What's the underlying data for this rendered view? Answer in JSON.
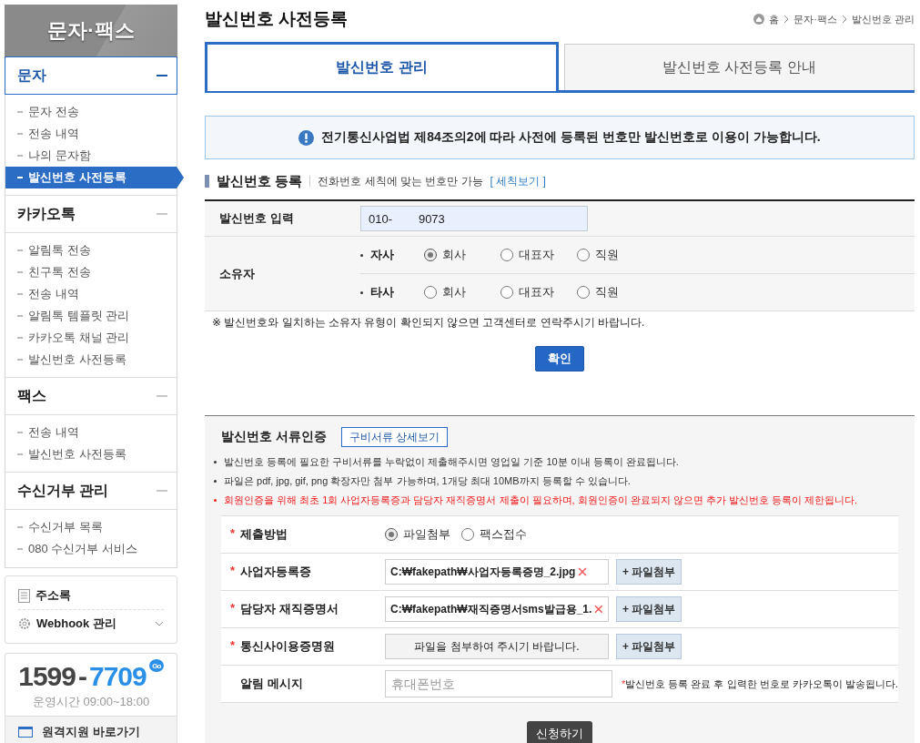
{
  "sidebar": {
    "title": "문자·팩스",
    "groups": [
      {
        "title": "문자",
        "selected": true,
        "expanded": true,
        "items": [
          {
            "label": "문자 전송",
            "selected": false
          },
          {
            "label": "전송 내역",
            "selected": false
          },
          {
            "label": "나의 문자함",
            "selected": false
          },
          {
            "label": "발신번호 사전등록",
            "selected": true
          }
        ]
      },
      {
        "title": "카카오톡",
        "selected": false,
        "expanded": true,
        "items": [
          {
            "label": "알림톡 전송",
            "selected": false
          },
          {
            "label": "친구톡 전송",
            "selected": false
          },
          {
            "label": "전송 내역",
            "selected": false
          },
          {
            "label": "알림톡 템플릿 관리",
            "selected": false
          },
          {
            "label": "카카오톡 채널 관리",
            "selected": false
          },
          {
            "label": "발신번호 사전등록",
            "selected": false
          }
        ]
      },
      {
        "title": "팩스",
        "selected": false,
        "expanded": true,
        "items": [
          {
            "label": "전송 내역",
            "selected": false
          },
          {
            "label": "발신번호 사전등록",
            "selected": false
          }
        ]
      },
      {
        "title": "수신거부 관리",
        "selected": false,
        "expanded": true,
        "items": [
          {
            "label": "수신거부 목록",
            "selected": false
          },
          {
            "label": "080 수신거부 서비스",
            "selected": false
          }
        ]
      }
    ],
    "quick_links": [
      {
        "kind": "addressbook",
        "label": "주소록"
      },
      {
        "kind": "webhook",
        "label": "Webhook 관리"
      }
    ],
    "contact": {
      "phone_prefix": "1599",
      "phone_separator": "-",
      "phone_suffix": "7709",
      "badge": "Go",
      "hours": "운영시간 09:00~18:00",
      "remote_link": "원격지원 바로가기"
    }
  },
  "page": {
    "title": "발신번호 사전등록",
    "breadcrumb": [
      "홈",
      "문자·팩스",
      "발신번호 관리"
    ]
  },
  "tabs": [
    {
      "label": "발신번호 관리",
      "selected": true
    },
    {
      "label": "발신번호 사전등록 안내",
      "selected": false
    }
  ],
  "notice": "전기통신사업법 제84조의2에 따라 사전에 등록된 번호만 발신번호로 이용이 가능합니다.",
  "register": {
    "heading": "발신번호 등록",
    "hint": "전화번호 세칙에 맞는 번호만 가능",
    "hint_link": "[ 세칙보기 ]",
    "number_label": "발신번호 입력",
    "number_value": "010-        9073",
    "owner_label": "소유자",
    "owner_groups": [
      {
        "label": "자사",
        "options": [
          {
            "label": "회사",
            "selected": true
          },
          {
            "label": "대표자",
            "selected": false
          },
          {
            "label": "직원",
            "selected": false
          }
        ]
      },
      {
        "label": "타사",
        "options": [
          {
            "label": "회사",
            "selected": false
          },
          {
            "label": "대표자",
            "selected": false
          },
          {
            "label": "직원",
            "selected": false
          }
        ]
      }
    ],
    "note": "※ 발신번호와 일치하는 소유자 유형이 확인되지 않으면 고객센터로 연락주시기 바랍니다.",
    "confirm_button": "확인"
  },
  "documents": {
    "heading": "발신번호 서류인증",
    "detail_button": "구비서류 상세보기",
    "notes": [
      {
        "text": "발신번호 등록에 필요한 구비서류를 누락없이 제출해주시면 영업일 기준 10분 이내 등록이 완료됩니다.",
        "warning": false
      },
      {
        "text": "파일은 pdf, jpg, gif, png 확장자만 첨부 가능하며, 1개당 최대 10MB까지 등록할 수 있습니다.",
        "warning": false
      },
      {
        "text": "회원인증을 위해 최초 1회 사업자등록증과 담당자 재직증명서 제출이 필요하며, 회원인증이 완료되지 않으면 추가 발신번호 등록이 제한됩니다.",
        "warning": true
      }
    ],
    "rows": [
      {
        "kind": "radio",
        "mark": "*",
        "label": "제출방법",
        "options": [
          {
            "label": "파일첨부",
            "selected": true
          },
          {
            "label": "팩스접수",
            "selected": false
          }
        ]
      },
      {
        "kind": "file",
        "mark": "*",
        "label": "사업자등록증",
        "value": "C:₩fakepath₩사업자등록증명_2.jpg",
        "attach_button": "+ 파일첨부"
      },
      {
        "kind": "file",
        "mark": "*",
        "label": "담당자 재직증명서",
        "value": "C:₩fakepath₩재직증명서sms발급용_1.",
        "attach_button": "+ 파일첨부"
      },
      {
        "kind": "file",
        "mark": "*",
        "label": "통신사이용증명원",
        "placeholder": "파일을 첨부하여 주시기 바랍니다.",
        "attach_button": "+ 파일첨부"
      },
      {
        "kind": "text",
        "label": "알림 메시지",
        "placeholder": "휴대폰번호",
        "note_mark": "*",
        "note": "발신번호 등록 완료 후 입력한 번호로 카카오톡이 발송됩니다."
      }
    ],
    "submit_button": "신청하기"
  }
}
